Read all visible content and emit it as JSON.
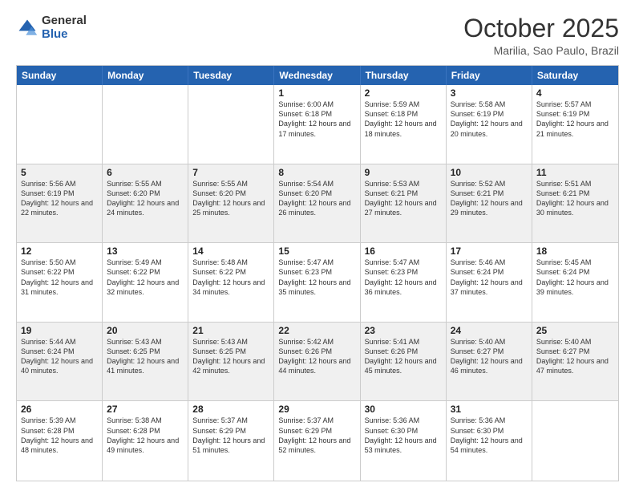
{
  "header": {
    "logo_general": "General",
    "logo_blue": "Blue",
    "month_title": "October 2025",
    "location": "Marilia, Sao Paulo, Brazil"
  },
  "calendar": {
    "days_of_week": [
      "Sunday",
      "Monday",
      "Tuesday",
      "Wednesday",
      "Thursday",
      "Friday",
      "Saturday"
    ],
    "rows": [
      [
        {
          "day": "",
          "info": "",
          "shaded": false
        },
        {
          "day": "",
          "info": "",
          "shaded": false
        },
        {
          "day": "",
          "info": "",
          "shaded": false
        },
        {
          "day": "1",
          "info": "Sunrise: 6:00 AM\nSunset: 6:18 PM\nDaylight: 12 hours and 17 minutes.",
          "shaded": false
        },
        {
          "day": "2",
          "info": "Sunrise: 5:59 AM\nSunset: 6:18 PM\nDaylight: 12 hours and 18 minutes.",
          "shaded": false
        },
        {
          "day": "3",
          "info": "Sunrise: 5:58 AM\nSunset: 6:19 PM\nDaylight: 12 hours and 20 minutes.",
          "shaded": false
        },
        {
          "day": "4",
          "info": "Sunrise: 5:57 AM\nSunset: 6:19 PM\nDaylight: 12 hours and 21 minutes.",
          "shaded": false
        }
      ],
      [
        {
          "day": "5",
          "info": "Sunrise: 5:56 AM\nSunset: 6:19 PM\nDaylight: 12 hours and 22 minutes.",
          "shaded": true
        },
        {
          "day": "6",
          "info": "Sunrise: 5:55 AM\nSunset: 6:20 PM\nDaylight: 12 hours and 24 minutes.",
          "shaded": true
        },
        {
          "day": "7",
          "info": "Sunrise: 5:55 AM\nSunset: 6:20 PM\nDaylight: 12 hours and 25 minutes.",
          "shaded": true
        },
        {
          "day": "8",
          "info": "Sunrise: 5:54 AM\nSunset: 6:20 PM\nDaylight: 12 hours and 26 minutes.",
          "shaded": true
        },
        {
          "day": "9",
          "info": "Sunrise: 5:53 AM\nSunset: 6:21 PM\nDaylight: 12 hours and 27 minutes.",
          "shaded": true
        },
        {
          "day": "10",
          "info": "Sunrise: 5:52 AM\nSunset: 6:21 PM\nDaylight: 12 hours and 29 minutes.",
          "shaded": true
        },
        {
          "day": "11",
          "info": "Sunrise: 5:51 AM\nSunset: 6:21 PM\nDaylight: 12 hours and 30 minutes.",
          "shaded": true
        }
      ],
      [
        {
          "day": "12",
          "info": "Sunrise: 5:50 AM\nSunset: 6:22 PM\nDaylight: 12 hours and 31 minutes.",
          "shaded": false
        },
        {
          "day": "13",
          "info": "Sunrise: 5:49 AM\nSunset: 6:22 PM\nDaylight: 12 hours and 32 minutes.",
          "shaded": false
        },
        {
          "day": "14",
          "info": "Sunrise: 5:48 AM\nSunset: 6:22 PM\nDaylight: 12 hours and 34 minutes.",
          "shaded": false
        },
        {
          "day": "15",
          "info": "Sunrise: 5:47 AM\nSunset: 6:23 PM\nDaylight: 12 hours and 35 minutes.",
          "shaded": false
        },
        {
          "day": "16",
          "info": "Sunrise: 5:47 AM\nSunset: 6:23 PM\nDaylight: 12 hours and 36 minutes.",
          "shaded": false
        },
        {
          "day": "17",
          "info": "Sunrise: 5:46 AM\nSunset: 6:24 PM\nDaylight: 12 hours and 37 minutes.",
          "shaded": false
        },
        {
          "day": "18",
          "info": "Sunrise: 5:45 AM\nSunset: 6:24 PM\nDaylight: 12 hours and 39 minutes.",
          "shaded": false
        }
      ],
      [
        {
          "day": "19",
          "info": "Sunrise: 5:44 AM\nSunset: 6:24 PM\nDaylight: 12 hours and 40 minutes.",
          "shaded": true
        },
        {
          "day": "20",
          "info": "Sunrise: 5:43 AM\nSunset: 6:25 PM\nDaylight: 12 hours and 41 minutes.",
          "shaded": true
        },
        {
          "day": "21",
          "info": "Sunrise: 5:43 AM\nSunset: 6:25 PM\nDaylight: 12 hours and 42 minutes.",
          "shaded": true
        },
        {
          "day": "22",
          "info": "Sunrise: 5:42 AM\nSunset: 6:26 PM\nDaylight: 12 hours and 44 minutes.",
          "shaded": true
        },
        {
          "day": "23",
          "info": "Sunrise: 5:41 AM\nSunset: 6:26 PM\nDaylight: 12 hours and 45 minutes.",
          "shaded": true
        },
        {
          "day": "24",
          "info": "Sunrise: 5:40 AM\nSunset: 6:27 PM\nDaylight: 12 hours and 46 minutes.",
          "shaded": true
        },
        {
          "day": "25",
          "info": "Sunrise: 5:40 AM\nSunset: 6:27 PM\nDaylight: 12 hours and 47 minutes.",
          "shaded": true
        }
      ],
      [
        {
          "day": "26",
          "info": "Sunrise: 5:39 AM\nSunset: 6:28 PM\nDaylight: 12 hours and 48 minutes.",
          "shaded": false
        },
        {
          "day": "27",
          "info": "Sunrise: 5:38 AM\nSunset: 6:28 PM\nDaylight: 12 hours and 49 minutes.",
          "shaded": false
        },
        {
          "day": "28",
          "info": "Sunrise: 5:37 AM\nSunset: 6:29 PM\nDaylight: 12 hours and 51 minutes.",
          "shaded": false
        },
        {
          "day": "29",
          "info": "Sunrise: 5:37 AM\nSunset: 6:29 PM\nDaylight: 12 hours and 52 minutes.",
          "shaded": false
        },
        {
          "day": "30",
          "info": "Sunrise: 5:36 AM\nSunset: 6:30 PM\nDaylight: 12 hours and 53 minutes.",
          "shaded": false
        },
        {
          "day": "31",
          "info": "Sunrise: 5:36 AM\nSunset: 6:30 PM\nDaylight: 12 hours and 54 minutes.",
          "shaded": false
        },
        {
          "day": "",
          "info": "",
          "shaded": false
        }
      ]
    ]
  }
}
